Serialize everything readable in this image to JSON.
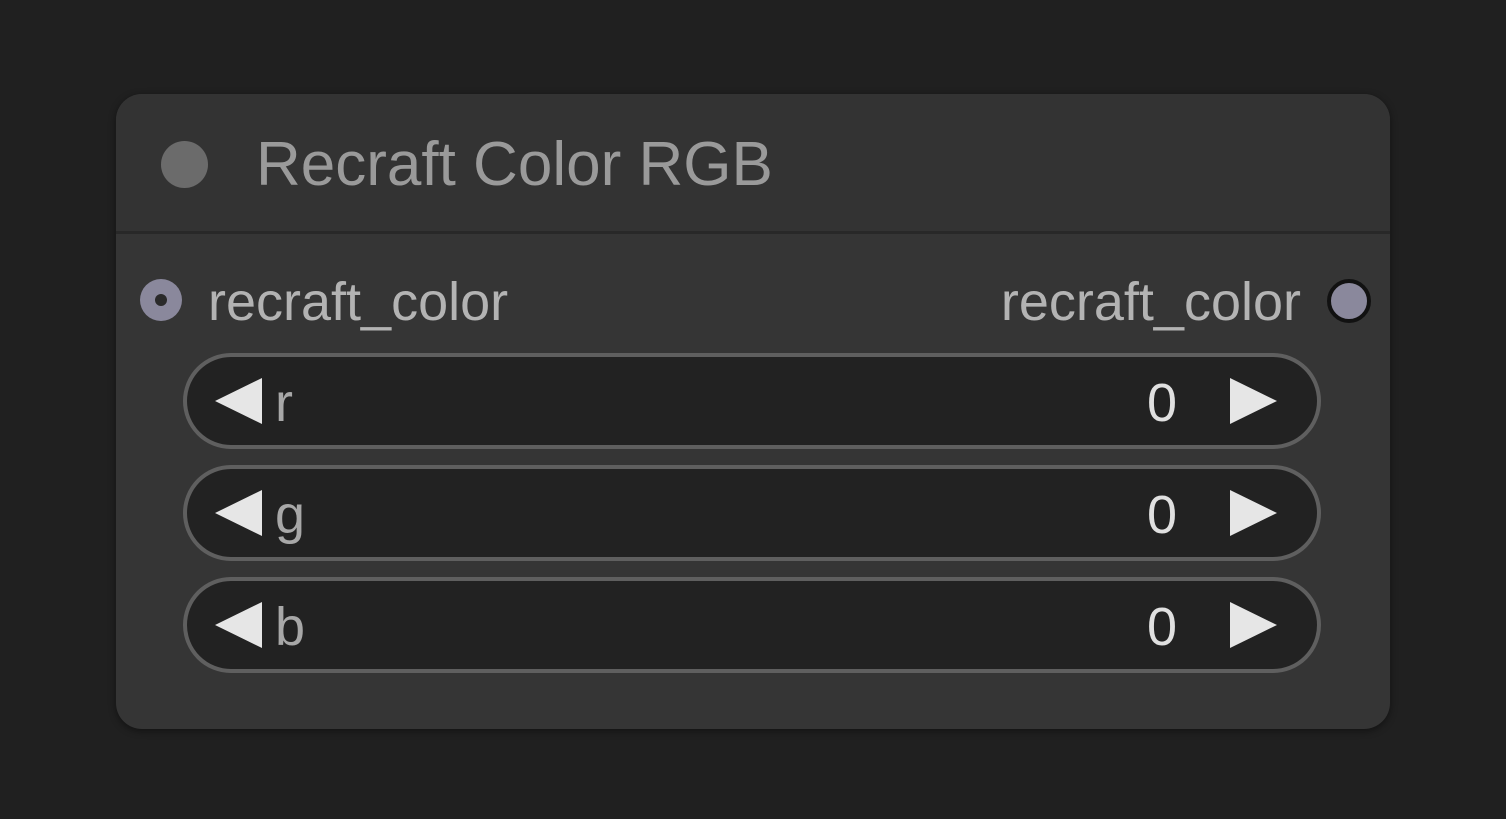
{
  "node": {
    "title": "Recraft Color RGB",
    "input": {
      "label": "recraft_color"
    },
    "output": {
      "label": "recraft_color"
    },
    "widgets": [
      {
        "name": "r",
        "value": "0"
      },
      {
        "name": "g",
        "value": "0"
      },
      {
        "name": "b",
        "value": "0"
      }
    ]
  },
  "colors": {
    "canvas": "#202020",
    "node_body": "#353535",
    "slot": "#8a889c",
    "widget_bg": "#222222",
    "widget_border": "#5f5f5f"
  },
  "icons": {
    "collapse": "circle-dot-icon",
    "decrement": "triangle-left-icon",
    "increment": "triangle-right-icon"
  }
}
